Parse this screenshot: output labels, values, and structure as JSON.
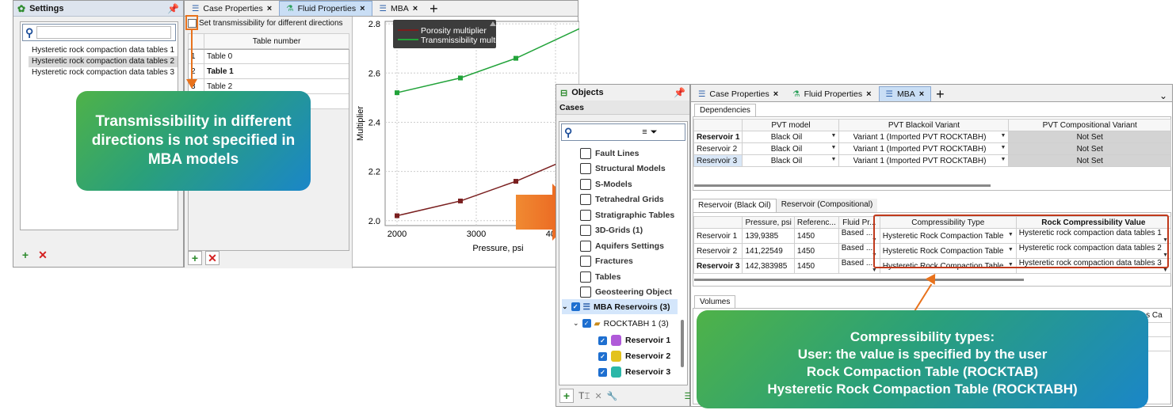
{
  "settings_panel": {
    "title": "Settings",
    "search_placeholder": "",
    "items": [
      {
        "label": "Hysteretic rock compaction data tables 1",
        "selected": false
      },
      {
        "label": "Hysteretic rock compaction data tables 2",
        "selected": true
      },
      {
        "label": "Hysteretic rock compaction data tables 3",
        "selected": false
      }
    ]
  },
  "left_main": {
    "tabs": [
      {
        "label": "Case Properties",
        "active": false
      },
      {
        "label": "Fluid Properties",
        "active": true
      },
      {
        "label": "MBA",
        "active": false
      }
    ],
    "checkbox_label": "Set transmissibility for different directions",
    "table_header": "Table number",
    "table_rows": [
      {
        "num": "1",
        "name": "Table 0",
        "bold": false
      },
      {
        "num": "2",
        "name": "Table 1",
        "bold": true
      },
      {
        "num": "3",
        "name": "Table 2",
        "bold": false
      }
    ]
  },
  "chart_data": {
    "type": "line",
    "title": "",
    "xlabel": "Pressure, psi",
    "ylabel": "Multiplier",
    "xlim": [
      1850,
      4300
    ],
    "ylim": [
      1.98,
      2.81
    ],
    "x_ticks": [
      2000,
      3000,
      4000
    ],
    "x_tick_labels": [
      "2000",
      "3000",
      "4000"
    ],
    "y_ticks": [
      2.0,
      2.2,
      2.4,
      2.6,
      2.8
    ],
    "y_tick_labels": [
      "2.0",
      "2.2",
      "2.4",
      "2.6",
      "2.8"
    ],
    "legend_position": "top-right",
    "grid": true,
    "series": [
      {
        "name": "Porosity multiplier",
        "color": "#7a1f1f",
        "x": [
          2000,
          2800,
          3500,
          4300
        ],
        "y": [
          2.02,
          2.08,
          2.16,
          2.27
        ]
      },
      {
        "name": "Transmissibility multiplier",
        "color": "#22a33a",
        "x": [
          2000,
          2800,
          3500,
          4300
        ],
        "y": [
          2.52,
          2.58,
          2.66,
          2.78
        ]
      }
    ]
  },
  "callout_left": {
    "text": "Transmissibility in different directions is not specified in MBA models"
  },
  "objects_panel": {
    "title": "Objects",
    "section": "Cases",
    "tree": [
      {
        "label": "Fault Lines",
        "icon": "fault-lines-icon"
      },
      {
        "label": "Structural Models",
        "icon": "structural-models-icon"
      },
      {
        "label": "S-Models",
        "icon": "s-models-icon"
      },
      {
        "label": "Tetrahedral Grids",
        "icon": "tetrahedral-grids-icon"
      },
      {
        "label": "Stratigraphic Tables",
        "icon": "stratigraphic-tables-icon"
      },
      {
        "label": "3D-Grids (1)",
        "icon": "grid-3d-icon"
      },
      {
        "label": "Aquifers Settings",
        "icon": "aquifers-icon"
      },
      {
        "label": "Fractures",
        "icon": "fractures-icon"
      },
      {
        "label": "Tables",
        "icon": "tables-icon"
      },
      {
        "label": "Geosteering Object",
        "icon": "geosteering-icon"
      }
    ],
    "mba": {
      "label": "MBA Reservoirs (3)",
      "case": "ROCKTABH 1 (3)",
      "reservoirs": [
        {
          "label": "Reservoir 1",
          "color": "#b05ad9"
        },
        {
          "label": "Reservoir 2",
          "color": "#e3c21c"
        },
        {
          "label": "Reservoir 3",
          "color": "#2bb7a8"
        }
      ]
    }
  },
  "right_main": {
    "tabs": [
      {
        "label": "Case Properties",
        "active": false
      },
      {
        "label": "Fluid Properties",
        "active": false
      },
      {
        "label": "MBA",
        "active": true
      }
    ],
    "dependencies_label": "Dependencies",
    "dep_headers": [
      "",
      "PVT model",
      "PVT Blackoil Variant",
      "PVT Compositional Variant"
    ],
    "dep_rows": [
      {
        "name": "Reservoir 1",
        "bold": true,
        "model": "Black Oil",
        "variant": "Variant 1 (Imported PVT ROCKTABH)",
        "comp": "Not Set"
      },
      {
        "name": "Reservoir 2",
        "bold": false,
        "model": "Black Oil",
        "variant": "Variant 1 (Imported PVT ROCKTABH)",
        "comp": "Not Set"
      },
      {
        "name": "Reservoir 3",
        "bold": false,
        "model": "Black Oil",
        "variant": "Variant 1 (Imported PVT ROCKTABH)",
        "comp": "Not Set"
      }
    ],
    "sub_tabs": [
      "Reservoir (Black Oil)",
      "Reservoir (Compositional)"
    ],
    "res_headers": [
      "",
      "Pressure, psi",
      "Referenc...",
      "Fluid Pr...",
      "Compressibility Type",
      "Rock Compressibility Value"
    ],
    "res_rows": [
      {
        "name": "Reservoir 1",
        "bold": false,
        "pressure": "139,9385",
        "ref": "1450",
        "fluid": "Based ...",
        "ctype": "Hysteretic Rock Compaction Table",
        "cval": "Hysteretic rock compaction data tables 1"
      },
      {
        "name": "Reservoir 2",
        "bold": false,
        "pressure": "141,22549",
        "ref": "1450",
        "fluid": "Based ...",
        "ctype": "Hysteretic Rock Compaction Table",
        "cval": "Hysteretic rock compaction data tables 2"
      },
      {
        "name": "Reservoir 3",
        "bold": true,
        "pressure": "142,383985",
        "ref": "1450",
        "fluid": "Based ...",
        "ctype": "Hysteretic Rock Compaction Table",
        "cval": "Hysteretic rock compaction data tables 3"
      }
    ],
    "volumes_label": "Volumes",
    "volumes_partial_header": "ial Gas Ca"
  },
  "callout_right": {
    "line1": "Compressibility types:",
    "line2": "User: the value is specified by the user",
    "line3": "Rock Compaction Table (ROCKTAB)",
    "line4": "Hysteretic Rock Compaction Table (ROCKTABH)"
  },
  "colors": {
    "orange": "#e8721c",
    "highlight_border": "#c0391b"
  }
}
